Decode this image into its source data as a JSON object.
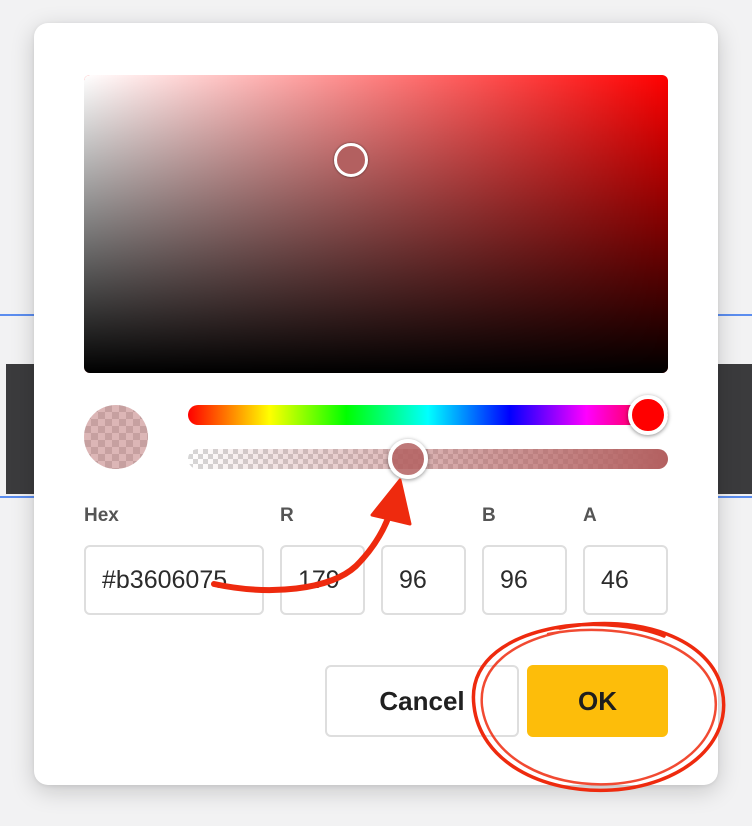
{
  "color_picker": {
    "selected_color": "#b36060",
    "hue_color": "#ff0000",
    "alpha_fraction": 0.46,
    "hue_degrees": 0,
    "labels": {
      "hex": "Hex",
      "r": "R",
      "b": "B",
      "a": "A"
    },
    "values": {
      "hex": "#b3606075",
      "r": "179",
      "g": "96",
      "b": "96",
      "a": "46"
    },
    "buttons": {
      "cancel": "Cancel",
      "ok": "OK"
    }
  },
  "colors": {
    "ok_button": "#fdbd0a",
    "annotation": "#ee2a0e"
  }
}
